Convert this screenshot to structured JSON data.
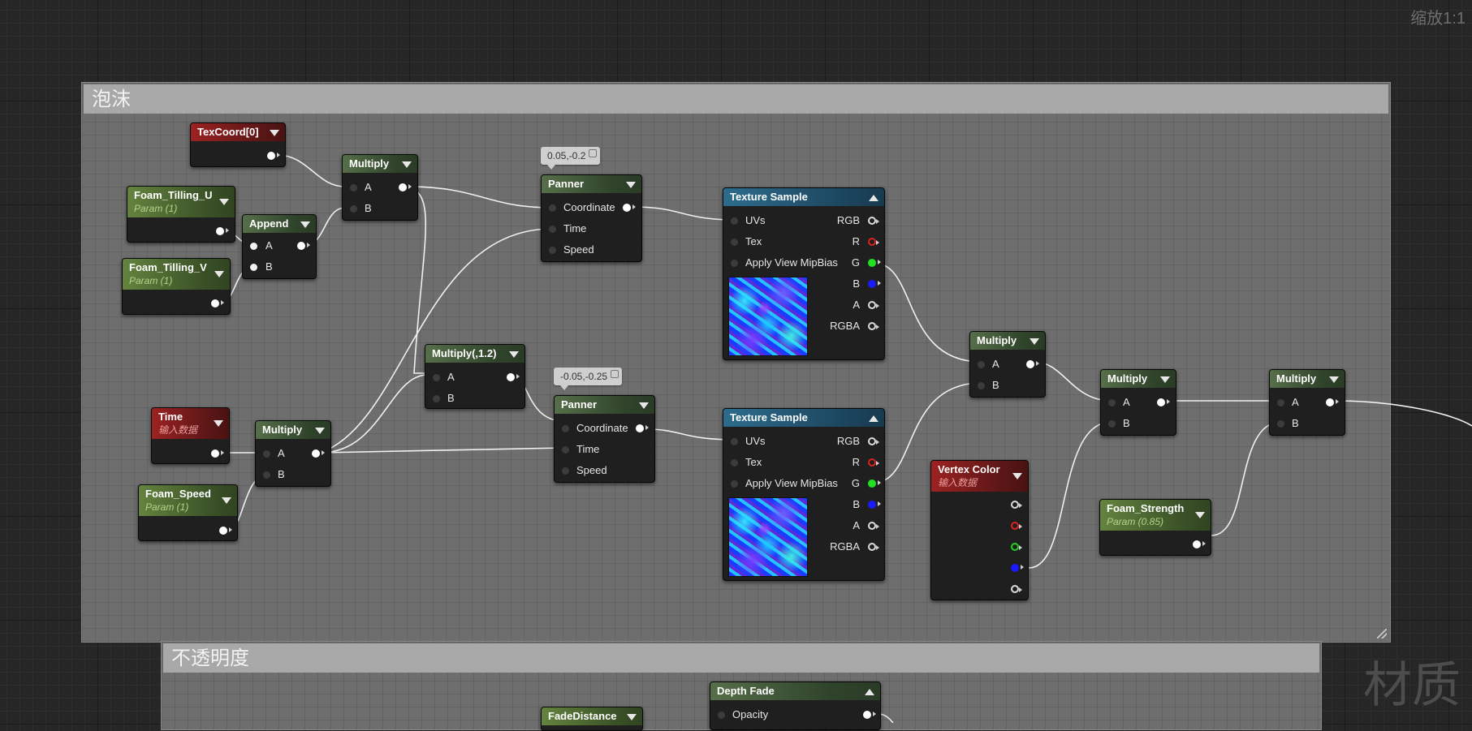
{
  "zoom_label": "缩放1:1",
  "watermark": "材质",
  "comments": {
    "foam_title": "泡沫",
    "opacity_title": "不透明度"
  },
  "nodes": {
    "texcoord": {
      "title": "TexCoord[0]"
    },
    "foam_tilling_u": {
      "title": "Foam_Tilling_U",
      "subtitle": "Param (1)"
    },
    "foam_tilling_v": {
      "title": "Foam_Tilling_V",
      "subtitle": "Param (1)"
    },
    "append": {
      "title": "Append",
      "pin_a": "A",
      "pin_b": "B"
    },
    "multiply_1": {
      "title": "Multiply",
      "pin_a": "A",
      "pin_b": "B"
    },
    "panner_1": {
      "title": "Panner",
      "bubble": "0.05,-0.2",
      "pin_coordinate": "Coordinate",
      "pin_time": "Time",
      "pin_speed": "Speed"
    },
    "texture_sample_1": {
      "title": "Texture Sample",
      "pin_uvs": "UVs",
      "pin_tex": "Tex",
      "pin_mip": "Apply View MipBias",
      "out_rgb": "RGB",
      "out_r": "R",
      "out_g": "G",
      "out_b": "B",
      "out_a": "A",
      "out_rgba": "RGBA"
    },
    "multiply_12": {
      "title": "Multiply(,1.2)",
      "pin_a": "A",
      "pin_b": "B"
    },
    "panner_2": {
      "title": "Panner",
      "bubble": "-0.05,-0.25",
      "pin_coordinate": "Coordinate",
      "pin_time": "Time",
      "pin_speed": "Speed"
    },
    "texture_sample_2": {
      "title": "Texture Sample",
      "pin_uvs": "UVs",
      "pin_tex": "Tex",
      "pin_mip": "Apply View MipBias",
      "out_rgb": "RGB",
      "out_r": "R",
      "out_g": "G",
      "out_b": "B",
      "out_a": "A",
      "out_rgba": "RGBA"
    },
    "time": {
      "title": "Time",
      "subtitle": "输入数据"
    },
    "foam_speed": {
      "title": "Foam_Speed",
      "subtitle": "Param (1)"
    },
    "multiply_time": {
      "title": "Multiply",
      "pin_a": "A",
      "pin_b": "B"
    },
    "multiply_mid": {
      "title": "Multiply",
      "pin_a": "A",
      "pin_b": "B"
    },
    "vertex_color": {
      "title": "Vertex Color",
      "subtitle": "输入数据"
    },
    "multiply_right1": {
      "title": "Multiply",
      "pin_a": "A",
      "pin_b": "B"
    },
    "foam_strength": {
      "title": "Foam_Strength",
      "subtitle": "Param (0.85)"
    },
    "multiply_right2": {
      "title": "Multiply",
      "pin_a": "A",
      "pin_b": "B"
    },
    "depth_fade": {
      "title": "Depth Fade",
      "pin_opacity": "Opacity"
    },
    "fade_distance": {
      "title": "FadeDistance"
    }
  }
}
